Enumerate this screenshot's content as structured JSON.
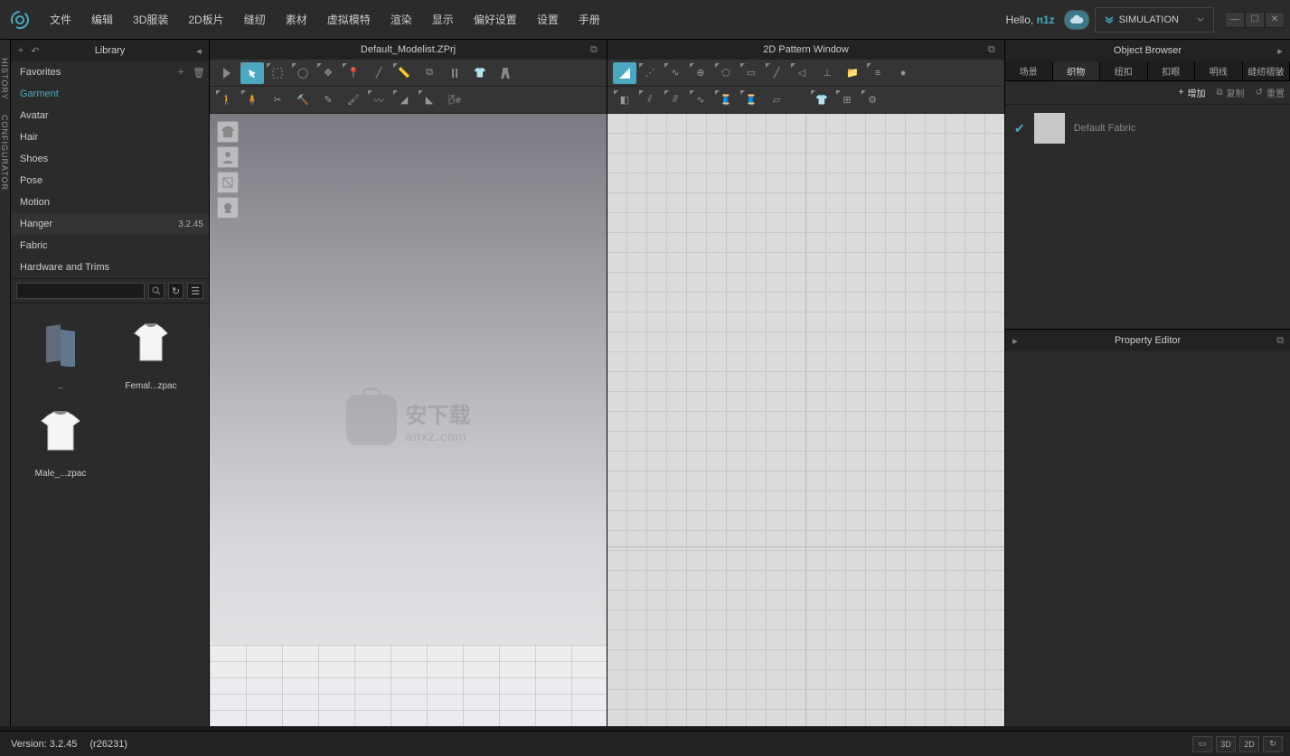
{
  "menubar": {
    "items": [
      "文件",
      "编辑",
      "3D服装",
      "2D板片",
      "缝纫",
      "素材",
      "虚拟模特",
      "渲染",
      "显示",
      "偏好设置",
      "设置",
      "手册"
    ],
    "hello": "Hello, ",
    "user": "n1z",
    "simulation": "SIMULATION"
  },
  "vtabs": [
    "HISTORY",
    "CONFIGURATOR"
  ],
  "library": {
    "title": "Library",
    "rows": {
      "favorites": "Favorites",
      "garment": "Garment",
      "avatar": "Avatar",
      "hair": "Hair",
      "shoes": "Shoes",
      "pose": "Pose",
      "motion": "Motion",
      "hanger": "Hanger",
      "hanger_ver": "3.2.45",
      "fabric": "Fabric",
      "hardware": "Hardware and Trims"
    },
    "thumbs": [
      {
        "label": ".."
      },
      {
        "label": "Femal...zpac"
      },
      {
        "label": "Male_...zpac"
      }
    ]
  },
  "win3d": {
    "title": "Default_Modelist.ZPrj"
  },
  "win2d": {
    "title": "2D Pattern Window"
  },
  "watermark": {
    "cn": "安下载",
    "url": "anxz.com"
  },
  "browser": {
    "title": "Object Browser",
    "tabs": [
      "场景",
      "织物",
      "纽扣",
      "扣眼",
      "明线",
      "缝纫褶皱"
    ],
    "actions": {
      "add": "增加",
      "copy": "复制",
      "reset": "重置"
    },
    "fabric_name": "Default Fabric"
  },
  "prop": {
    "title": "Property Editor"
  },
  "status": {
    "version": "Version: 3.2.45",
    "build": "(r26231)",
    "btns": [
      "3D",
      "2D"
    ]
  }
}
